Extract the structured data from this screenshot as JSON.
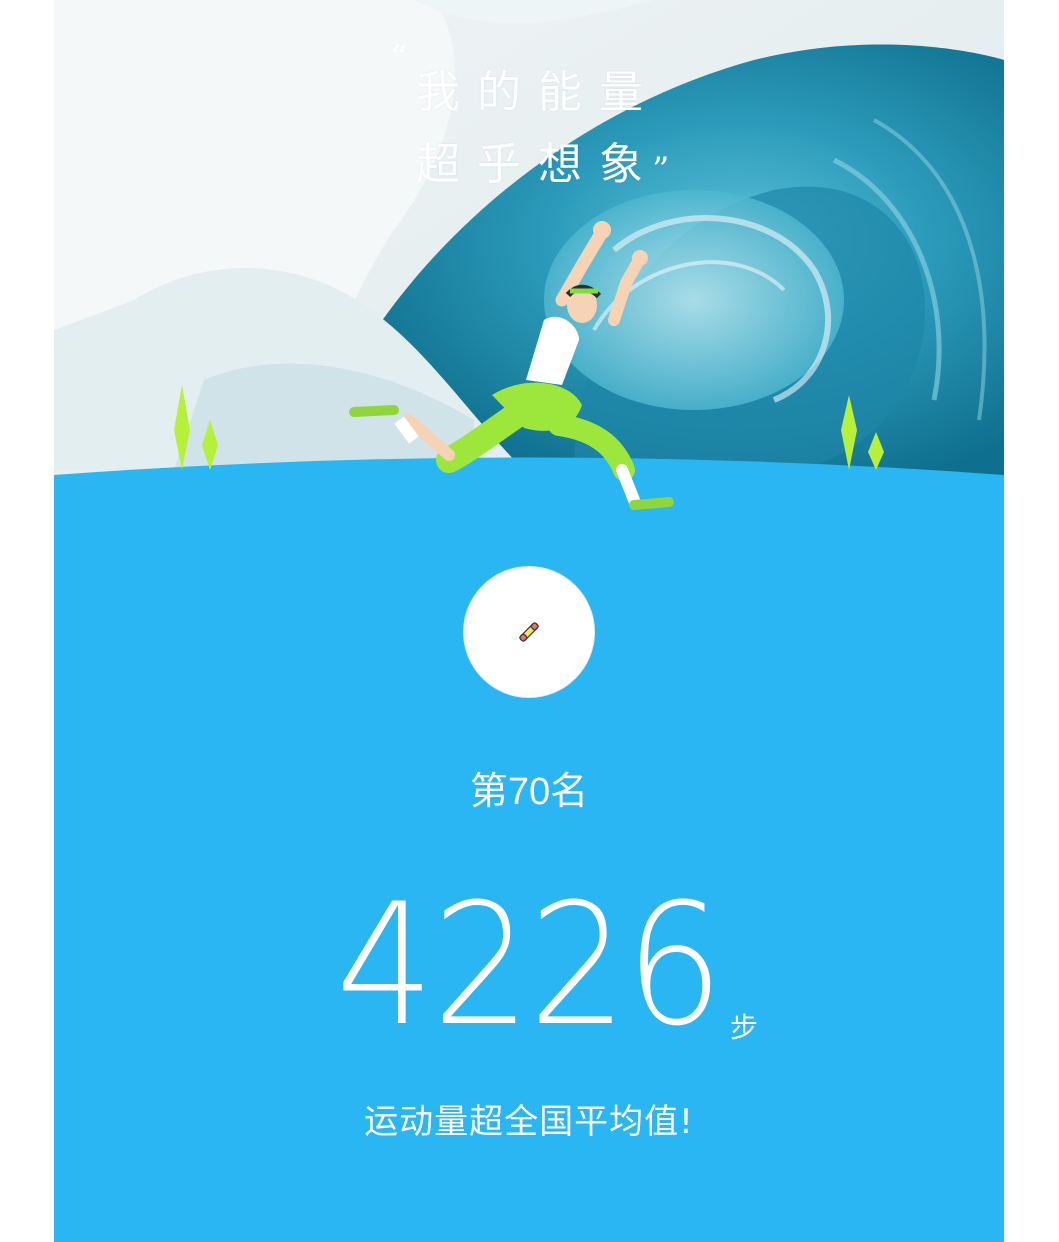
{
  "hero": {
    "quote_line_1": "我的能量",
    "quote_line_2": "超乎想象",
    "quote_open": "“",
    "quote_close": "”",
    "background": "ocean-wave-illustration",
    "figure": "running-man-illustration"
  },
  "medal": {
    "icon": "ribbon-icon"
  },
  "rank": {
    "label": "第70名"
  },
  "steps": {
    "value": "4226",
    "unit": "步"
  },
  "comment": "运动量超全国平均值!",
  "colors": {
    "accent": "#29b6f2",
    "wave_dark": "#1b7fa0",
    "wave_light": "#7fd1e0",
    "grass": "#b6f03a"
  }
}
